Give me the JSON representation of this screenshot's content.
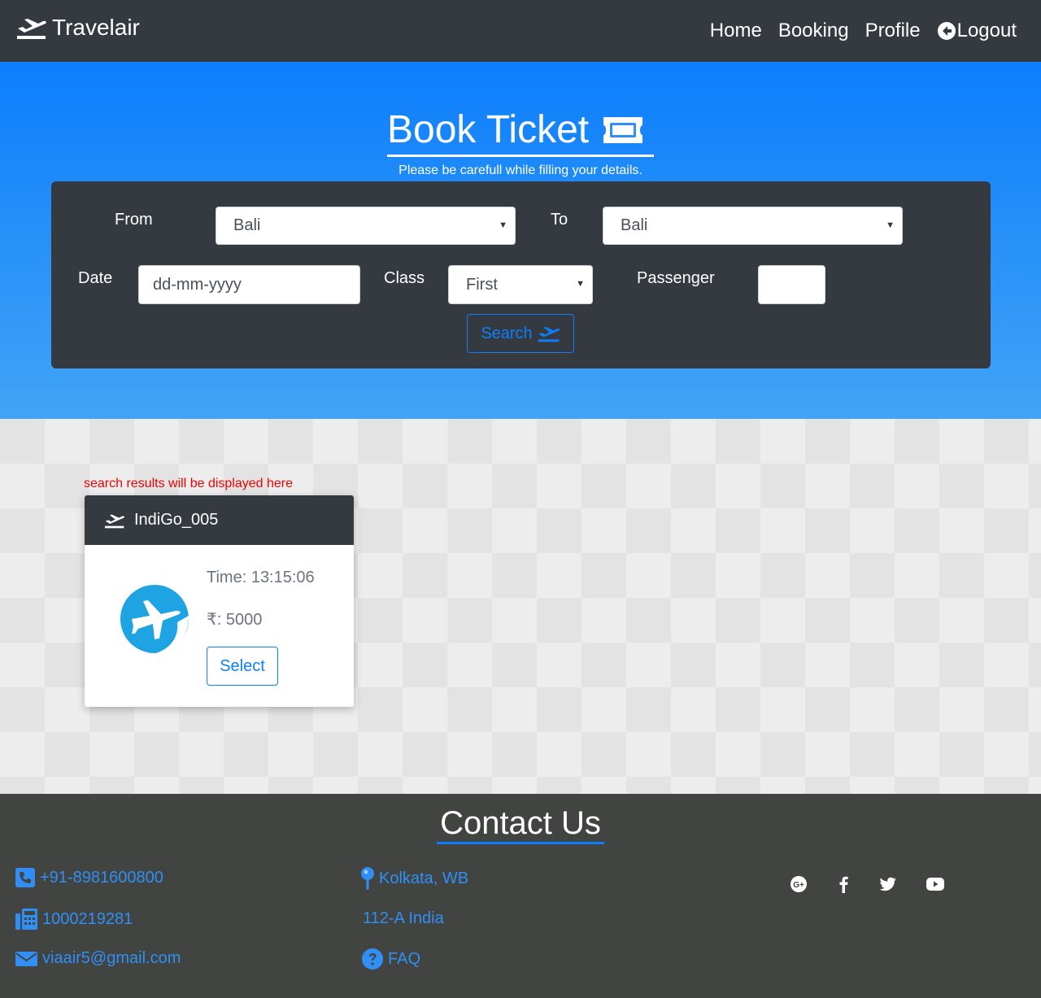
{
  "navbar": {
    "brand": "Travelair",
    "links": [
      "Home",
      "Booking",
      "Profile",
      "Logout"
    ]
  },
  "hero": {
    "title": "Book Ticket",
    "subtitle": "Please be carefull while filling your details."
  },
  "form": {
    "from_label": "From",
    "from_value": "Bali",
    "to_label": "To",
    "to_value": "Bali",
    "date_label": "Date",
    "date_placeholder": "dd-mm-yyyy",
    "class_label": "Class",
    "class_value": "First",
    "passenger_label": "Passenger",
    "passenger_value": "",
    "search_label": "Search"
  },
  "results": {
    "note": "search results will be displayed here",
    "flights": [
      {
        "name": "IndiGo_005",
        "time": "Time: 13:15:06",
        "price": "₹: 5000",
        "select_label": "Select"
      }
    ]
  },
  "footer": {
    "title": "Contact Us",
    "phone": "+91-8981600800",
    "fax": "1000219281",
    "email": "viaair5@gmail.com",
    "city": "Kolkata, WB",
    "address": "112-A India",
    "faq": "FAQ",
    "social": [
      "google-plus-icon",
      "facebook-icon",
      "twitter-icon",
      "youtube-icon"
    ]
  },
  "colors": {
    "dark": "#343a40",
    "primary": "#0d7efc",
    "footer_bg": "#424442",
    "link": "#2f8ff5",
    "note": "#ee0000"
  }
}
